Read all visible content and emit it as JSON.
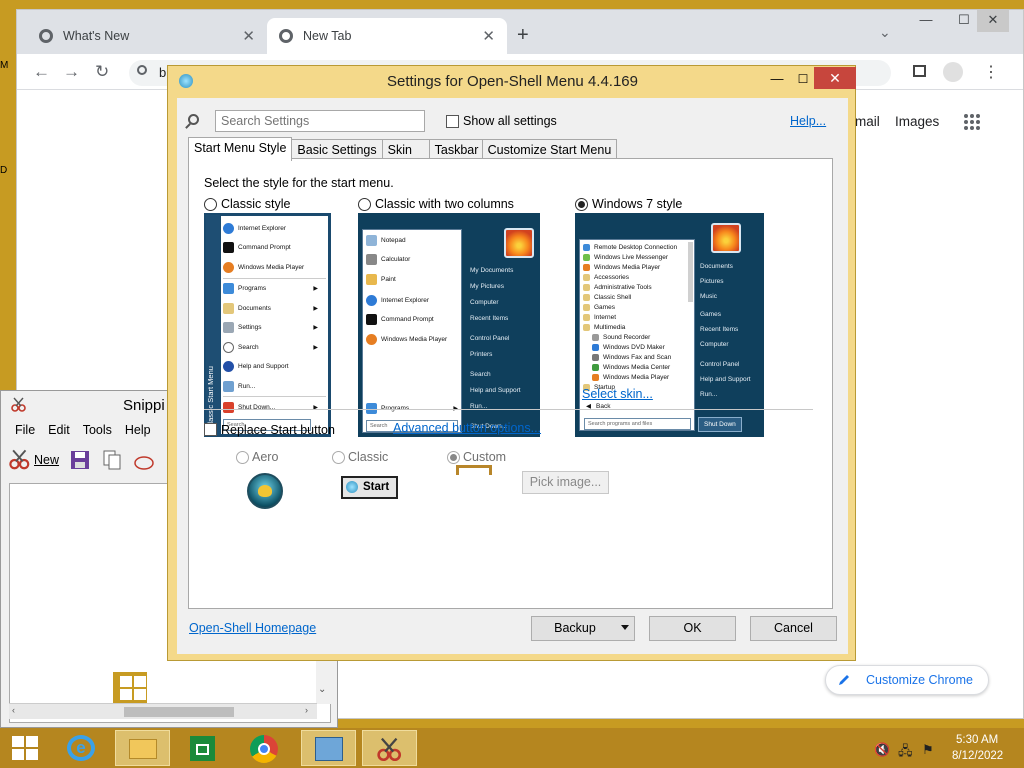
{
  "chrome": {
    "tabs": [
      {
        "label": "What's New"
      },
      {
        "label": "New Tab"
      }
    ],
    "omnibox_text": "b",
    "gmail_label": "mail",
    "images_label": "Images",
    "customize_label": "Customize Chrome",
    "window_controls": {
      "minimize": "—",
      "maximize": "☐",
      "close": "✕"
    }
  },
  "desktop": {
    "left_chars": [
      "M",
      "D"
    ]
  },
  "snipping": {
    "title": "Snippi",
    "menu": [
      "File",
      "Edit",
      "Tools",
      "Help"
    ],
    "new_label": "New"
  },
  "dialog": {
    "title": "Settings for Open-Shell Menu 4.4.169",
    "search_placeholder": "Search Settings",
    "show_all_label": "Show all settings",
    "help_label": "Help...",
    "tabs": [
      "Start Menu Style",
      "Basic Settings",
      "Skin",
      "Taskbar",
      "Customize Start Menu"
    ],
    "intro": "Select the style for the start menu.",
    "styles": [
      {
        "label": "Classic style",
        "selected": false
      },
      {
        "label": "Classic with two columns",
        "selected": false
      },
      {
        "label": "Windows 7 style",
        "selected": true
      }
    ],
    "classic_preview": {
      "side_label": "Classic Start Menu",
      "items": [
        "Internet Explorer",
        "Command Prompt",
        "Windows Media Player",
        "Programs",
        "Documents",
        "Settings",
        "Search",
        "Help and Support",
        "Run...",
        "Shut Down..."
      ],
      "search": "Search"
    },
    "twocol_preview": {
      "left": [
        "Notepad",
        "Calculator",
        "Paint",
        "Internet Explorer",
        "Command Prompt",
        "Windows Media Player"
      ],
      "programs": "Programs",
      "right": [
        "My Documents",
        "My Pictures",
        "Computer",
        "Recent Items",
        "Control Panel",
        "Printers",
        "Search",
        "Help and Support",
        "Run...",
        "Shut Down..."
      ],
      "search": "Search"
    },
    "win7_preview": {
      "left": [
        "Remote Desktop Connection",
        "Windows Live Messenger",
        "Windows Media Player",
        "Accessories",
        "Administrative Tools",
        "Classic Shell",
        "Games",
        "Internet",
        "Multimedia",
        "Sound Recorder",
        "Windows DVD Maker",
        "Windows Fax and Scan",
        "Windows Media Center",
        "Windows Media Player",
        "Startup"
      ],
      "back": "Back",
      "search": "Search programs and files",
      "right": [
        "Documents",
        "Pictures",
        "Music",
        "Games",
        "Recent Items",
        "Computer",
        "Control Panel",
        "Help and Support",
        "Run..."
      ],
      "shutdown": "Shut Down"
    },
    "select_skin": "Select skin...",
    "replace_label": "Replace Start button",
    "advanced_label": "Advanced button options...",
    "button_styles": [
      {
        "label": "Aero",
        "selected": false
      },
      {
        "label": "Classic",
        "selected": false
      },
      {
        "label": "Custom",
        "selected": true
      }
    ],
    "classic_start_label": "Start",
    "pick_image": "Pick image...",
    "homepage": "Open-Shell Homepage",
    "backup": "Backup",
    "ok": "OK",
    "cancel": "Cancel"
  },
  "taskbar": {
    "time": "5:30 AM",
    "date": "8/12/2022"
  },
  "colors": {
    "desktop": "#c79b22",
    "taskbar": "#b5861f",
    "dialog_frame": "#f4d98a",
    "link": "#0066cc",
    "close_red": "#c7463d"
  }
}
